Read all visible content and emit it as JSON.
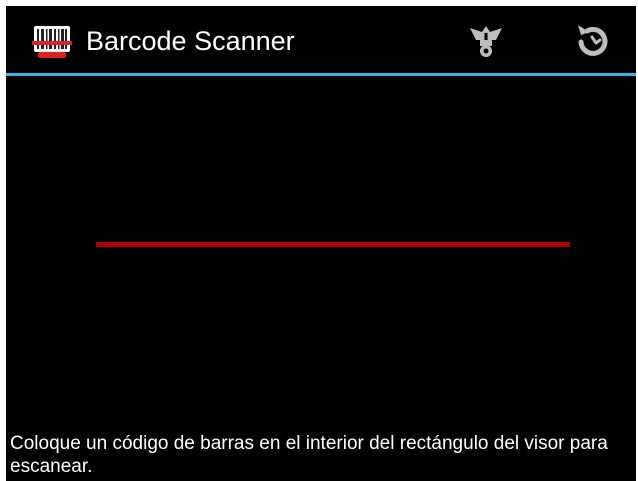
{
  "action_bar": {
    "title": "Barcode Scanner",
    "app_icon": "barcode-icon",
    "share_icon": "share-icon",
    "history_icon": "history-icon",
    "divider_color": "#33b5e5"
  },
  "viewfinder": {
    "laser_color": "#b00000"
  },
  "status": {
    "text": "Coloque un código de barras en el interior del rectángulo del visor para escanear."
  }
}
